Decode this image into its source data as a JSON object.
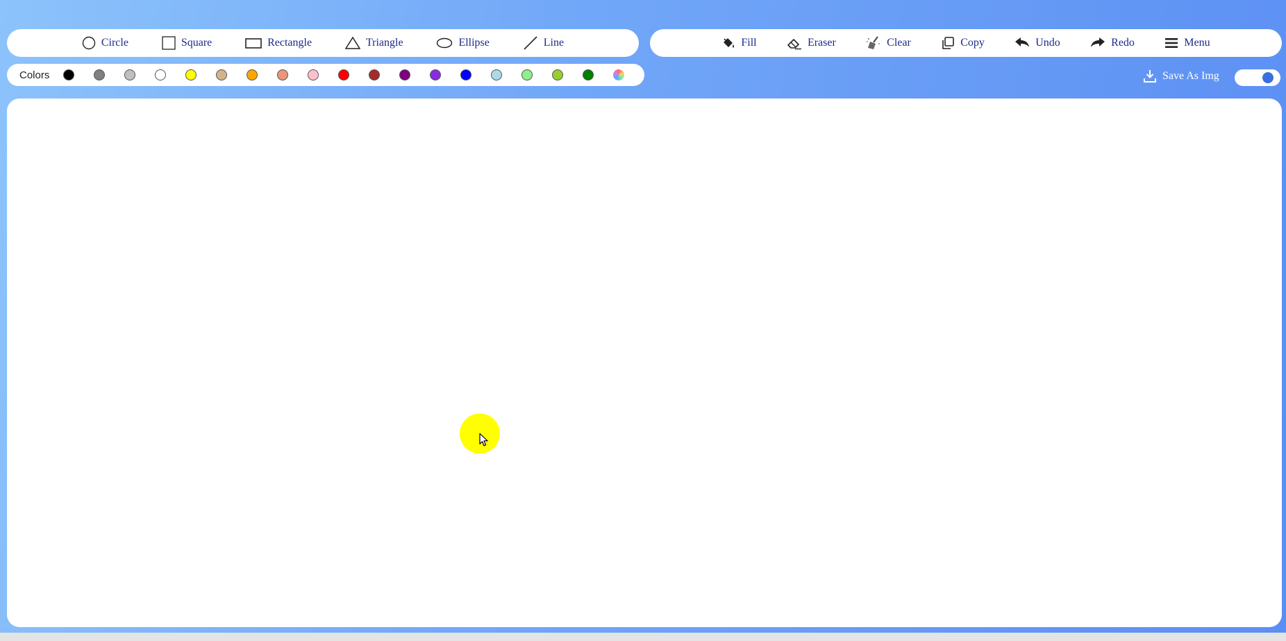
{
  "shapes": {
    "circle_label": "Circle",
    "square_label": "Square",
    "rectangle_label": "Rectangle",
    "triangle_label": "Triangle",
    "ellipse_label": "Ellipse",
    "line_label": "Line"
  },
  "tools": {
    "fill_label": "Fill",
    "eraser_label": "Eraser",
    "clear_label": "Clear",
    "copy_label": "Copy",
    "undo_label": "Undo",
    "redo_label": "Redo",
    "menu_label": "Menu"
  },
  "colors": {
    "label": "Colors",
    "swatches": [
      {
        "name": "black",
        "hex": "#000000"
      },
      {
        "name": "gray",
        "hex": "#808080"
      },
      {
        "name": "silver",
        "hex": "#c0c0c0"
      },
      {
        "name": "white",
        "hex": "#ffffff"
      },
      {
        "name": "yellow",
        "hex": "#ffff00"
      },
      {
        "name": "tan",
        "hex": "#d2b48c"
      },
      {
        "name": "orange",
        "hex": "#ffa500"
      },
      {
        "name": "darksalmon",
        "hex": "#e9967a"
      },
      {
        "name": "pink",
        "hex": "#ffc0cb"
      },
      {
        "name": "red",
        "hex": "#ff0000"
      },
      {
        "name": "brown",
        "hex": "#a52a2a"
      },
      {
        "name": "purple",
        "hex": "#800080"
      },
      {
        "name": "blueviolet",
        "hex": "#8a2be2"
      },
      {
        "name": "blue",
        "hex": "#0000ff"
      },
      {
        "name": "lightblue",
        "hex": "#add8e6"
      },
      {
        "name": "lightgreen",
        "hex": "#90ee90"
      },
      {
        "name": "yellowgreen",
        "hex": "#9acd32"
      },
      {
        "name": "green",
        "hex": "#008000"
      },
      {
        "name": "custom-color-picker",
        "hex": "rainbow"
      }
    ]
  },
  "save": {
    "label": "Save As Img"
  },
  "theme": {
    "accent": "#3b6fe0",
    "label_color": "#1b2a8a",
    "cursor_highlight": "#ffff00"
  }
}
